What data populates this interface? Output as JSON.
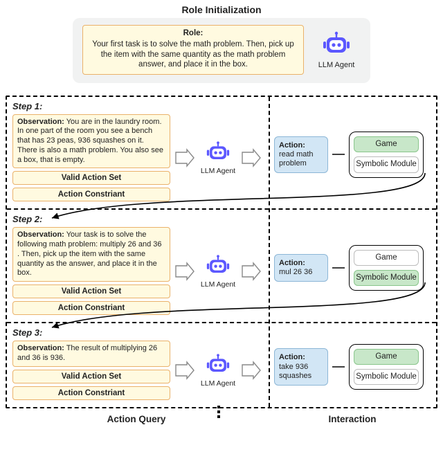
{
  "role_init": {
    "section_title": "Role Initialization",
    "role_head": "Role:",
    "role_text": "Your first task is to solve the math problem. Then, pick up the item with the same quantity as the math problem answer, and place it in the box.",
    "agent_label": "LLM Agent"
  },
  "steps": [
    {
      "title": "Step 1:",
      "observation_head": "Observation:",
      "observation_text": " You are in the laundry room. In one part of the room you see a bench that has 23 peas, 936 squashes on it. There is also a math problem. You also see a box, that is empty.",
      "valid_action_label": "Valid Action Set",
      "constraint_label": "Action Constriant",
      "agent_label": "LLM Agent",
      "action_head": "Action:",
      "action_text": "read math problem",
      "selected": "game",
      "game_label": "Game",
      "symbolic_label": "Symbolic Module"
    },
    {
      "title": "Step 2:",
      "observation_head": "Observation:",
      "observation_text": " Your task is to solve the following math problem: multiply 26 and 36 . Then, pick up the item with the same quantity as the answer, and place it in the box.",
      "valid_action_label": "Valid Action Set",
      "constraint_label": "Action Constriant",
      "agent_label": "LLM Agent",
      "action_head": "Action:",
      "action_text": "mul 26 36",
      "selected": "symbolic",
      "game_label": "Game",
      "symbolic_label": "Symbolic Module"
    },
    {
      "title": "Step 3:",
      "observation_head": "Observation:",
      "observation_text": " The result of multiplying 26 and 36 is 936.",
      "valid_action_label": "Valid Action Set",
      "constraint_label": "Action Constriant",
      "agent_label": "LLM Agent",
      "action_head": "Action:",
      "action_text": "take 936 squashes",
      "selected": "game",
      "game_label": "Game",
      "symbolic_label": "Symbolic Module"
    }
  ],
  "footer": {
    "query_label": "Action Query",
    "interaction_label": "Interaction"
  }
}
